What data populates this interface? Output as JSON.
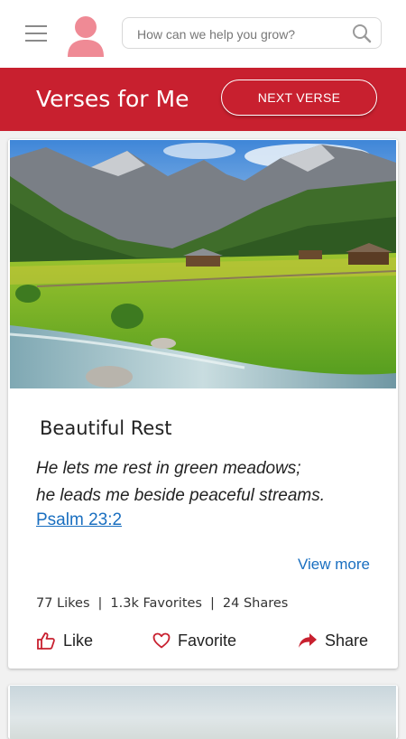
{
  "search": {
    "placeholder": "How can we help you grow?"
  },
  "banner": {
    "title": "Verses for Me",
    "next_label": "NEXT VERSE"
  },
  "card": {
    "title": "Beautiful Rest",
    "verse_line1": "He lets me rest in green meadows;",
    "verse_line2": "he leads me beside peaceful streams.",
    "reference": "Psalm 23:2",
    "view_more": "View more",
    "stats": {
      "likes": "77 Likes",
      "favorites": "1.3k Favorites",
      "shares": "24 Shares",
      "separator": "|"
    },
    "actions": {
      "like": "Like",
      "favorite": "Favorite",
      "share": "Share"
    }
  },
  "colors": {
    "brand_red": "#c8202f",
    "link_blue": "#1a6fc0",
    "avatar_pink": "#ef8a95"
  },
  "icons": [
    "menu-icon",
    "avatar-icon",
    "search-icon",
    "thumbs-up-icon",
    "heart-icon",
    "share-arrow-icon"
  ]
}
